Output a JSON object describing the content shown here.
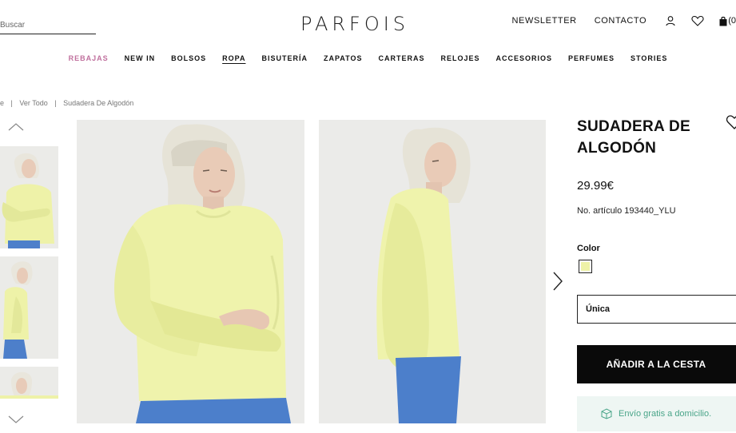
{
  "header": {
    "search_placeholder": "Buscar",
    "logo": "PARFOIS",
    "newsletter": "NEWSLETTER",
    "contacto": "CONTACTO",
    "cart_count": "(0"
  },
  "nav": [
    {
      "label": "REBAJAS",
      "state": "sale"
    },
    {
      "label": "NEW IN",
      "state": ""
    },
    {
      "label": "BOLSOS",
      "state": ""
    },
    {
      "label": "ROPA",
      "state": "active"
    },
    {
      "label": "BISUTERÍA",
      "state": ""
    },
    {
      "label": "ZAPATOS",
      "state": ""
    },
    {
      "label": "CARTERAS",
      "state": ""
    },
    {
      "label": "RELOJES",
      "state": ""
    },
    {
      "label": "ACCESORIOS",
      "state": ""
    },
    {
      "label": "PERFUMES",
      "state": ""
    },
    {
      "label": "STORIES",
      "state": ""
    }
  ],
  "breadcrumb": {
    "first": "e",
    "second": "Ver Todo",
    "current": "Sudadera De Algodón"
  },
  "product": {
    "title": "SUDADERA DE ALGODÓN",
    "price": "29.99€",
    "sku": "No. artículo 193440_YLU",
    "color_label": "Color",
    "color_hex": "#eef2a8",
    "size": "Única",
    "add_to_cart": "AÑADIR A LA CESTA",
    "shipping": "Envío gratis a domicilio."
  },
  "colors": {
    "sale": "#c0709e",
    "shipping_text": "#4aa589",
    "shipping_bg": "#eef6f3",
    "button_bg": "#0a0a0a"
  }
}
